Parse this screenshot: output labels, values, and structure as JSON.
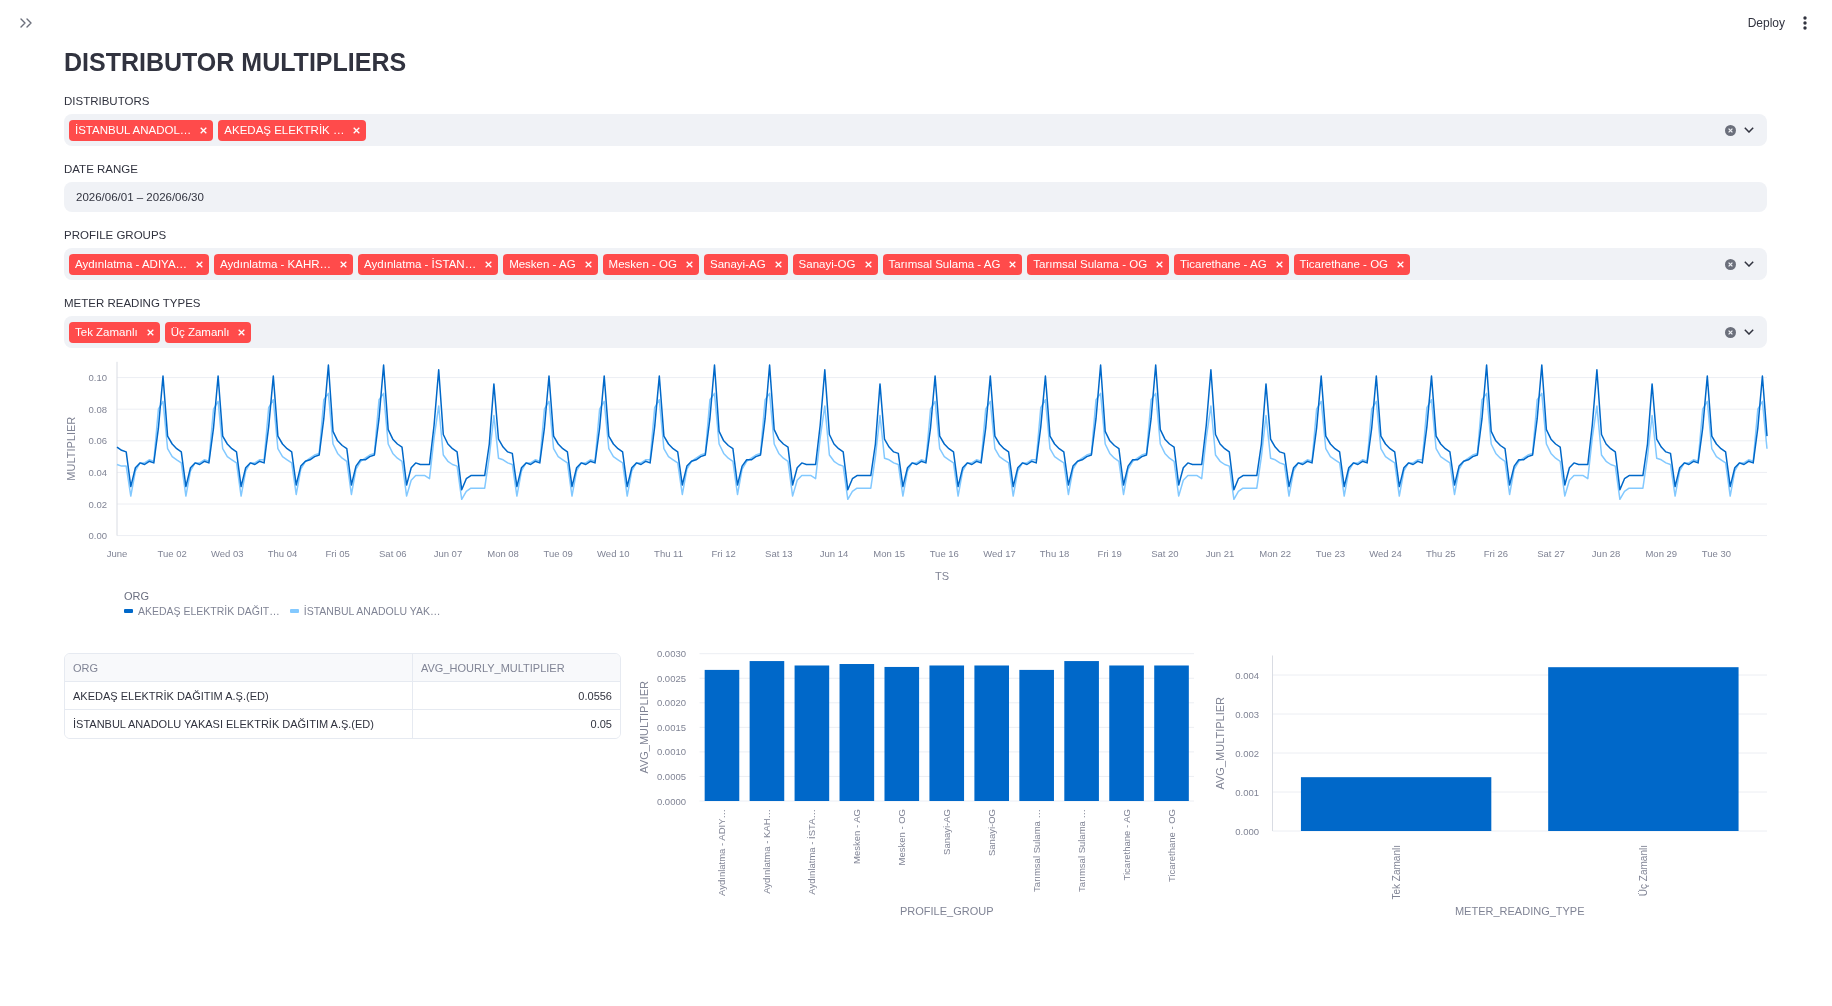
{
  "header": {
    "button": "Deploy"
  },
  "title": "DISTRIBUTOR MULTIPLIERS",
  "filters": [
    {
      "kind": "multiselect",
      "label": "DISTRIBUTORS",
      "tags": [
        "İSTANBUL ANADOL…",
        "AKEDAŞ ELEKTRİK …"
      ]
    },
    {
      "kind": "date",
      "label": "DATE RANGE",
      "value": "2026/06/01 – 2026/06/30"
    },
    {
      "kind": "multiselect",
      "label": "PROFILE GROUPS",
      "tags": [
        "Aydınlatma - ADIYA…",
        "Aydınlatma - KAHR…",
        "Aydınlatma - İSTAN…",
        "Mesken - AG",
        "Mesken - OG",
        "Sanayi-AG",
        "Sanayi-OG",
        "Tarımsal Sulama - AG",
        "Tarımsal Sulama - OG",
        "Ticarethane - AG",
        "Ticarethane - OG"
      ]
    },
    {
      "kind": "multiselect",
      "label": "METER READING TYPES",
      "tags": [
        "Tek Zamanlı",
        "Üç Zamanlı"
      ]
    }
  ],
  "line_chart": {
    "legend_title": "ORG",
    "chart_data": {
      "type": "line",
      "xlabel": "TS",
      "ylabel": "MULTIPLIER",
      "grid": true,
      "categories": [
        "June",
        null,
        null,
        null,
        null,
        null,
        null,
        null,
        null,
        null,
        null,
        null,
        "Tue 02",
        null,
        null,
        null,
        null,
        null,
        null,
        null,
        null,
        null,
        null,
        null,
        "Wed 03",
        null,
        null,
        null,
        null,
        null,
        null,
        null,
        null,
        null,
        null,
        null,
        "Thu 04",
        null,
        null,
        null,
        null,
        null,
        null,
        null,
        null,
        null,
        null,
        null,
        "Fri 05",
        null,
        null,
        null,
        null,
        null,
        null,
        null,
        null,
        null,
        null,
        null,
        "Sat 06",
        null,
        null,
        null,
        null,
        null,
        null,
        null,
        null,
        null,
        null,
        null,
        "Jun 07",
        null,
        null,
        null,
        null,
        null,
        null,
        null,
        null,
        null,
        null,
        null,
        "Mon 08",
        null,
        null,
        null,
        null,
        null,
        null,
        null,
        null,
        null,
        null,
        null,
        "Tue 09",
        null,
        null,
        null,
        null,
        null,
        null,
        null,
        null,
        null,
        null,
        null,
        "Wed 10",
        null,
        null,
        null,
        null,
        null,
        null,
        null,
        null,
        null,
        null,
        null,
        "Thu 11",
        null,
        null,
        null,
        null,
        null,
        null,
        null,
        null,
        null,
        null,
        null,
        "Fri 12",
        null,
        null,
        null,
        null,
        null,
        null,
        null,
        null,
        null,
        null,
        null,
        "Sat 13",
        null,
        null,
        null,
        null,
        null,
        null,
        null,
        null,
        null,
        null,
        null,
        "Jun 14",
        null,
        null,
        null,
        null,
        null,
        null,
        null,
        null,
        null,
        null,
        null,
        "Mon 15",
        null,
        null,
        null,
        null,
        null,
        null,
        null,
        null,
        null,
        null,
        null,
        "Tue 16",
        null,
        null,
        null,
        null,
        null,
        null,
        null,
        null,
        null,
        null,
        null,
        "Wed 17",
        null,
        null,
        null,
        null,
        null,
        null,
        null,
        null,
        null,
        null,
        null,
        "Thu 18",
        null,
        null,
        null,
        null,
        null,
        null,
        null,
        null,
        null,
        null,
        null,
        "Fri 19",
        null,
        null,
        null,
        null,
        null,
        null,
        null,
        null,
        null,
        null,
        null,
        "Sat 20",
        null,
        null,
        null,
        null,
        null,
        null,
        null,
        null,
        null,
        null,
        null,
        "Jun 21",
        null,
        null,
        null,
        null,
        null,
        null,
        null,
        null,
        null,
        null,
        null,
        "Mon 22",
        null,
        null,
        null,
        null,
        null,
        null,
        null,
        null,
        null,
        null,
        null,
        "Tue 23",
        null,
        null,
        null,
        null,
        null,
        null,
        null,
        null,
        null,
        null,
        null,
        "Wed 24",
        null,
        null,
        null,
        null,
        null,
        null,
        null,
        null,
        null,
        null,
        null,
        "Thu 25",
        null,
        null,
        null,
        null,
        null,
        null,
        null,
        null,
        null,
        null,
        null,
        "Fri 26",
        null,
        null,
        null,
        null,
        null,
        null,
        null,
        null,
        null,
        null,
        null,
        "Sat 27",
        null,
        null,
        null,
        null,
        null,
        null,
        null,
        null,
        null,
        null,
        null,
        "Jun 28",
        null,
        null,
        null,
        null,
        null,
        null,
        null,
        null,
        null,
        null,
        null,
        "Mon 29",
        null,
        null,
        null,
        null,
        null,
        null,
        null,
        null,
        null,
        null,
        null,
        "Tue 30",
        null,
        null,
        null,
        null,
        null,
        null,
        null,
        null,
        null,
        null,
        null
      ],
      "ylim": [
        0,
        0.11
      ],
      "yticks": [
        {
          "value": 0,
          "label": "0.00"
        },
        {
          "value": 0.02,
          "label": "0.02"
        },
        {
          "value": 0.04,
          "label": "0.04"
        },
        {
          "value": 0.06,
          "label": "0.06"
        },
        {
          "value": 0.08,
          "label": "0.08"
        },
        {
          "value": 0.1,
          "label": "0.10"
        }
      ],
      "series": [
        {
          "name": "AKEDAŞ ELEKTRİK DAĞIT…",
          "color": "#0068c9",
          "values": [
            0.056,
            0.054,
            0.053,
            0.031,
            0.043,
            0.046,
            0.045,
            0.047,
            0.046,
            0.068,
            0.101,
            0.063,
            0.058,
            0.055,
            0.053,
            0.031,
            0.043,
            0.046,
            0.045,
            0.047,
            0.046,
            0.068,
            0.101,
            0.063,
            0.058,
            0.055,
            0.053,
            0.031,
            0.043,
            0.046,
            0.045,
            0.047,
            0.046,
            0.069,
            0.101,
            0.063,
            0.058,
            0.055,
            0.053,
            0.032,
            0.044,
            0.047,
            0.048,
            0.05,
            0.051,
            0.074,
            0.108,
            0.066,
            0.06,
            0.057,
            0.055,
            0.032,
            0.044,
            0.048,
            0.048,
            0.05,
            0.051,
            0.074,
            0.108,
            0.067,
            0.061,
            0.058,
            0.056,
            0.032,
            0.043,
            0.046,
            0.045,
            0.045,
            0.045,
            0.07,
            0.105,
            0.064,
            0.058,
            0.055,
            0.053,
            0.029,
            0.036,
            0.038,
            0.038,
            0.038,
            0.038,
            0.058,
            0.096,
            0.061,
            0.056,
            0.053,
            0.052,
            0.031,
            0.043,
            0.046,
            0.045,
            0.047,
            0.046,
            0.068,
            0.101,
            0.063,
            0.058,
            0.055,
            0.053,
            0.031,
            0.043,
            0.046,
            0.045,
            0.047,
            0.046,
            0.068,
            0.101,
            0.063,
            0.058,
            0.055,
            0.053,
            0.031,
            0.043,
            0.046,
            0.045,
            0.047,
            0.046,
            0.069,
            0.101,
            0.063,
            0.058,
            0.055,
            0.053,
            0.032,
            0.044,
            0.047,
            0.048,
            0.05,
            0.051,
            0.074,
            0.108,
            0.066,
            0.06,
            0.057,
            0.055,
            0.032,
            0.044,
            0.048,
            0.048,
            0.05,
            0.051,
            0.074,
            0.108,
            0.067,
            0.061,
            0.058,
            0.056,
            0.032,
            0.043,
            0.046,
            0.045,
            0.045,
            0.045,
            0.07,
            0.105,
            0.064,
            0.058,
            0.055,
            0.053,
            0.029,
            0.036,
            0.038,
            0.038,
            0.038,
            0.038,
            0.058,
            0.096,
            0.061,
            0.056,
            0.053,
            0.052,
            0.031,
            0.043,
            0.046,
            0.045,
            0.047,
            0.046,
            0.068,
            0.101,
            0.063,
            0.058,
            0.055,
            0.053,
            0.031,
            0.043,
            0.046,
            0.045,
            0.047,
            0.046,
            0.068,
            0.101,
            0.063,
            0.058,
            0.055,
            0.053,
            0.031,
            0.043,
            0.046,
            0.045,
            0.047,
            0.046,
            0.069,
            0.101,
            0.063,
            0.058,
            0.055,
            0.053,
            0.032,
            0.044,
            0.047,
            0.048,
            0.05,
            0.051,
            0.074,
            0.108,
            0.066,
            0.06,
            0.057,
            0.055,
            0.032,
            0.044,
            0.048,
            0.048,
            0.05,
            0.051,
            0.074,
            0.108,
            0.067,
            0.061,
            0.058,
            0.056,
            0.032,
            0.043,
            0.046,
            0.045,
            0.045,
            0.045,
            0.07,
            0.105,
            0.064,
            0.058,
            0.055,
            0.053,
            0.029,
            0.036,
            0.038,
            0.038,
            0.038,
            0.038,
            0.058,
            0.096,
            0.061,
            0.056,
            0.053,
            0.052,
            0.031,
            0.043,
            0.046,
            0.045,
            0.047,
            0.046,
            0.068,
            0.101,
            0.063,
            0.058,
            0.055,
            0.053,
            0.031,
            0.043,
            0.046,
            0.045,
            0.047,
            0.046,
            0.068,
            0.101,
            0.063,
            0.058,
            0.055,
            0.053,
            0.031,
            0.043,
            0.046,
            0.045,
            0.047,
            0.046,
            0.069,
            0.101,
            0.063,
            0.058,
            0.055,
            0.053,
            0.032,
            0.044,
            0.047,
            0.048,
            0.05,
            0.051,
            0.074,
            0.108,
            0.066,
            0.06,
            0.057,
            0.055,
            0.032,
            0.044,
            0.048,
            0.048,
            0.05,
            0.051,
            0.074,
            0.108,
            0.067,
            0.061,
            0.058,
            0.056,
            0.032,
            0.043,
            0.046,
            0.045,
            0.045,
            0.045,
            0.07,
            0.105,
            0.064,
            0.058,
            0.055,
            0.053,
            0.029,
            0.036,
            0.038,
            0.038,
            0.038,
            0.038,
            0.058,
            0.096,
            0.061,
            0.056,
            0.053,
            0.052,
            0.031,
            0.043,
            0.046,
            0.045,
            0.047,
            0.046,
            0.068,
            0.101,
            0.063,
            0.058,
            0.055,
            0.053,
            0.031,
            0.043,
            0.046,
            0.045,
            0.047,
            0.046,
            0.068,
            0.101,
            0.063
          ]
        },
        {
          "name": "İSTANBUL ANADOLU YAK…",
          "color": "#83c9ff",
          "values": [
            0.045,
            0.044,
            0.044,
            0.025,
            0.041,
            0.046,
            0.046,
            0.048,
            0.047,
            0.08,
            0.085,
            0.055,
            0.05,
            0.048,
            0.046,
            0.025,
            0.041,
            0.046,
            0.046,
            0.048,
            0.047,
            0.08,
            0.085,
            0.055,
            0.05,
            0.048,
            0.046,
            0.025,
            0.041,
            0.046,
            0.046,
            0.048,
            0.048,
            0.081,
            0.086,
            0.055,
            0.05,
            0.048,
            0.046,
            0.026,
            0.042,
            0.047,
            0.049,
            0.051,
            0.052,
            0.086,
            0.09,
            0.058,
            0.052,
            0.049,
            0.047,
            0.026,
            0.042,
            0.047,
            0.049,
            0.051,
            0.052,
            0.086,
            0.09,
            0.058,
            0.052,
            0.049,
            0.047,
            0.025,
            0.035,
            0.038,
            0.038,
            0.038,
            0.036,
            0.062,
            0.082,
            0.051,
            0.047,
            0.045,
            0.044,
            0.023,
            0.028,
            0.03,
            0.03,
            0.03,
            0.03,
            0.05,
            0.076,
            0.049,
            0.048,
            0.046,
            0.045,
            0.025,
            0.041,
            0.046,
            0.046,
            0.048,
            0.047,
            0.08,
            0.085,
            0.055,
            0.05,
            0.048,
            0.046,
            0.025,
            0.041,
            0.046,
            0.046,
            0.048,
            0.047,
            0.08,
            0.085,
            0.055,
            0.05,
            0.048,
            0.046,
            0.025,
            0.041,
            0.046,
            0.046,
            0.048,
            0.048,
            0.081,
            0.086,
            0.055,
            0.05,
            0.048,
            0.046,
            0.026,
            0.042,
            0.047,
            0.049,
            0.051,
            0.052,
            0.086,
            0.09,
            0.058,
            0.052,
            0.049,
            0.047,
            0.026,
            0.042,
            0.047,
            0.049,
            0.051,
            0.052,
            0.086,
            0.09,
            0.058,
            0.052,
            0.049,
            0.047,
            0.025,
            0.035,
            0.038,
            0.038,
            0.038,
            0.036,
            0.062,
            0.082,
            0.051,
            0.047,
            0.045,
            0.044,
            0.023,
            0.028,
            0.03,
            0.03,
            0.03,
            0.03,
            0.05,
            0.076,
            0.049,
            0.048,
            0.046,
            0.045,
            0.025,
            0.041,
            0.046,
            0.046,
            0.048,
            0.047,
            0.08,
            0.085,
            0.055,
            0.05,
            0.048,
            0.046,
            0.025,
            0.041,
            0.046,
            0.046,
            0.048,
            0.047,
            0.08,
            0.085,
            0.055,
            0.05,
            0.048,
            0.046,
            0.025,
            0.041,
            0.046,
            0.046,
            0.048,
            0.048,
            0.081,
            0.086,
            0.055,
            0.05,
            0.048,
            0.046,
            0.026,
            0.042,
            0.047,
            0.049,
            0.051,
            0.052,
            0.086,
            0.09,
            0.058,
            0.052,
            0.049,
            0.047,
            0.026,
            0.042,
            0.047,
            0.049,
            0.051,
            0.052,
            0.086,
            0.09,
            0.058,
            0.052,
            0.049,
            0.047,
            0.025,
            0.035,
            0.038,
            0.038,
            0.038,
            0.036,
            0.062,
            0.082,
            0.051,
            0.047,
            0.045,
            0.044,
            0.023,
            0.028,
            0.03,
            0.03,
            0.03,
            0.03,
            0.05,
            0.076,
            0.049,
            0.048,
            0.046,
            0.045,
            0.025,
            0.041,
            0.046,
            0.046,
            0.048,
            0.047,
            0.08,
            0.085,
            0.055,
            0.05,
            0.048,
            0.046,
            0.025,
            0.041,
            0.046,
            0.046,
            0.048,
            0.047,
            0.08,
            0.085,
            0.055,
            0.05,
            0.048,
            0.046,
            0.025,
            0.041,
            0.046,
            0.046,
            0.048,
            0.048,
            0.081,
            0.086,
            0.055,
            0.05,
            0.048,
            0.046,
            0.026,
            0.042,
            0.047,
            0.049,
            0.051,
            0.052,
            0.086,
            0.09,
            0.058,
            0.052,
            0.049,
            0.047,
            0.026,
            0.042,
            0.047,
            0.049,
            0.051,
            0.052,
            0.086,
            0.09,
            0.058,
            0.052,
            0.049,
            0.047,
            0.025,
            0.035,
            0.038,
            0.038,
            0.038,
            0.036,
            0.062,
            0.082,
            0.051,
            0.047,
            0.045,
            0.044,
            0.023,
            0.028,
            0.03,
            0.03,
            0.03,
            0.03,
            0.05,
            0.076,
            0.049,
            0.048,
            0.046,
            0.045,
            0.025,
            0.041,
            0.046,
            0.046,
            0.048,
            0.047,
            0.08,
            0.085,
            0.055,
            0.05,
            0.048,
            0.046,
            0.025,
            0.041,
            0.046,
            0.046,
            0.048,
            0.047,
            0.08,
            0.085,
            0.055
          ]
        }
      ]
    }
  },
  "table": {
    "columns": [
      "ORG",
      "AVG_HOURLY_MULTIPLIER"
    ],
    "rows": [
      [
        "AKEDAŞ ELEKTRİK DAĞITIM A.Ş.(ED)",
        "0.0556"
      ],
      [
        "İSTANBUL ANADOLU YAKASI ELEKTRİK DAĞITIM A.Ş.(ED)",
        "0.05"
      ]
    ]
  },
  "bar_charts": [
    {
      "chart_data": {
        "type": "bar",
        "xlabel": "PROFILE_GROUP",
        "ylabel": "AVG_MULTIPLIER",
        "grid": true,
        "categories": [
          "Aydınlatma - ADIY…",
          "Aydınlatma - KAH…",
          "Aydınlatma - İSTA…",
          "Mesken - AG",
          "Mesken - OG",
          "Sanayi-AG",
          "Sanayi-OG",
          "Tarımsal Sulama …",
          "Tarımsal Sulama …",
          "Ticarethane - AG",
          "Ticarethane - OG"
        ],
        "values": [
          0.00267,
          0.00285,
          0.00276,
          0.00279,
          0.00273,
          0.00276,
          0.00276,
          0.00267,
          0.00285,
          0.00276,
          0.00276
        ],
        "ylim": [
          0,
          0.003
        ],
        "yticks": [
          {
            "value": 0,
            "label": "0.0000"
          },
          {
            "value": 0.0005,
            "label": "0.0005"
          },
          {
            "value": 0.001,
            "label": "0.0010"
          },
          {
            "value": 0.0015,
            "label": "0.0015"
          },
          {
            "value": 0.002,
            "label": "0.0020"
          },
          {
            "value": 0.0025,
            "label": "0.0025"
          },
          {
            "value": 0.003,
            "label": "0.0030"
          }
        ]
      }
    },
    {
      "chart_data": {
        "type": "bar",
        "xlabel": "METER_READING_TYPE",
        "ylabel": "AVG_MULTIPLIER",
        "grid": true,
        "categories": [
          "Tek Zamanlı",
          "Üç Zamanlı"
        ],
        "values": [
          0.00138,
          0.0042
        ],
        "ylim": [
          0,
          0.0045
        ],
        "yticks": [
          {
            "value": 0,
            "label": "0.000"
          },
          {
            "value": 0.001,
            "label": "0.001"
          },
          {
            "value": 0.002,
            "label": "0.002"
          },
          {
            "value": 0.003,
            "label": "0.003"
          },
          {
            "value": 0.004,
            "label": "0.004"
          }
        ]
      }
    }
  ]
}
